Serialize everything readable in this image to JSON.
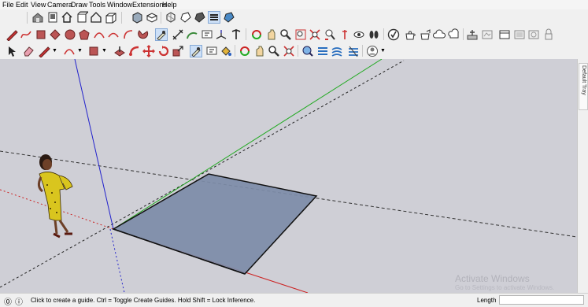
{
  "menu": [
    "File",
    "Edit",
    "View",
    "Camera",
    "Draw",
    "Tools",
    "Window",
    "Extensions",
    "Help"
  ],
  "toolbar_icons": {
    "row1": [
      "warehouse-icon",
      "model-info-icon",
      "home-view-icon",
      "component-box-icon",
      "house-outline-icon",
      "component-open-icon",
      "front-view-icon",
      "top-view-icon",
      "style-shaded-icon",
      "style-xray-icon",
      "style-wireframe-icon",
      "style-hidden-line-icon",
      "layers-icon",
      "style-textured-icon"
    ],
    "row2": [
      "pencil-line-icon",
      "freehand-icon",
      "rectangle-icon",
      "rotated-rectangle-icon",
      "circle-icon",
      "polygon-icon",
      "arc-icon",
      "two-point-arc-icon",
      "three-point-arc-icon",
      "pie-icon",
      "tape-measure-icon",
      "dimension-icon",
      "protractor-icon",
      "text-icon",
      "axes-icon",
      "3d-text-icon",
      "orbit-icon",
      "pan-icon",
      "zoom-icon",
      "zoom-window-icon",
      "zoom-extents-icon",
      "previous-view-icon",
      "position-camera-icon",
      "look-around-icon",
      "walk-icon",
      "validate-icon",
      "teapot-icon",
      "share-model-icon",
      "cloud-icon",
      "extension-warehouse-icon",
      "add-location-icon",
      "toggle-terrain-icon",
      "photo-texture-icon",
      "section-plane-icon"
    ],
    "row3": [
      "select-icon",
      "eraser-icon",
      "line-pencil-icon",
      "arcs-dropdown-icon",
      "shapes-dropdown-icon",
      "push-pull-icon",
      "follow-me-icon",
      "move-icon",
      "rotate-icon",
      "scale-icon",
      "tape-measure-icon",
      "text-label-icon",
      "paint-bucket-icon",
      "orbit-icon",
      "pan-icon",
      "zoom-icon",
      "zoom-extents-icon",
      "solid-tools-icon",
      "sandbox-icon",
      "intersect-icon",
      "outer-shell-icon",
      "user-account-icon"
    ]
  },
  "tray": {
    "label": "Default Tray"
  },
  "status": {
    "message": "Click to create a guide. Ctrl = Toggle Create Guides. Hold Shift = Lock Inference.",
    "length_label": "Length",
    "length_value": ""
  },
  "watermark": {
    "line1": "Activate Windows",
    "line2": "Go to Settings to activate Windows."
  },
  "colors": {
    "red_axis": "#cc2222",
    "green_axis": "#22aa22",
    "blue_axis": "#2222cc",
    "face": "#7d8ca8",
    "background": "#cfcfd6"
  }
}
